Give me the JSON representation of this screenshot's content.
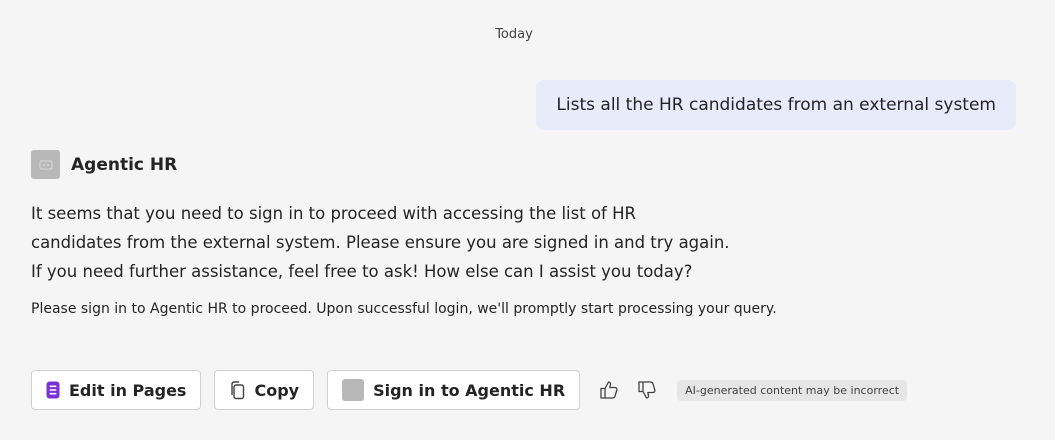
{
  "conversation": {
    "date_label": "Today",
    "user_message": "Lists all the HR candidates from an external system",
    "bot": {
      "name": "Agentic HR",
      "avatar_icon": "bot-avatar-icon",
      "response_lines": [
        "It seems that you need to sign in to proceed with accessing the list of HR",
        "candidates from the external system. Please ensure you are signed in and try again.",
        "If you need further assistance, feel free to ask! How else can I assist you today?"
      ],
      "signin_note": "Please sign in to Agentic HR to proceed. Upon successful login, we'll promptly start processing your query."
    }
  },
  "actions": {
    "edit_in_pages_label": "Edit in Pages",
    "copy_label": "Copy",
    "sign_in_label": "Sign in to Agentic HR",
    "thumbs_up_icon": "thumbs-up-icon",
    "thumbs_down_icon": "thumbs-down-icon",
    "disclaimer": "AI-generated content may be incorrect"
  },
  "colors": {
    "page_background": "#f5f5f5",
    "user_bubble": "#e8ebfa",
    "pages_icon": "#7b2fd6",
    "button_border": "#d1d1d1",
    "disclaimer_background": "#e6e6e6"
  }
}
